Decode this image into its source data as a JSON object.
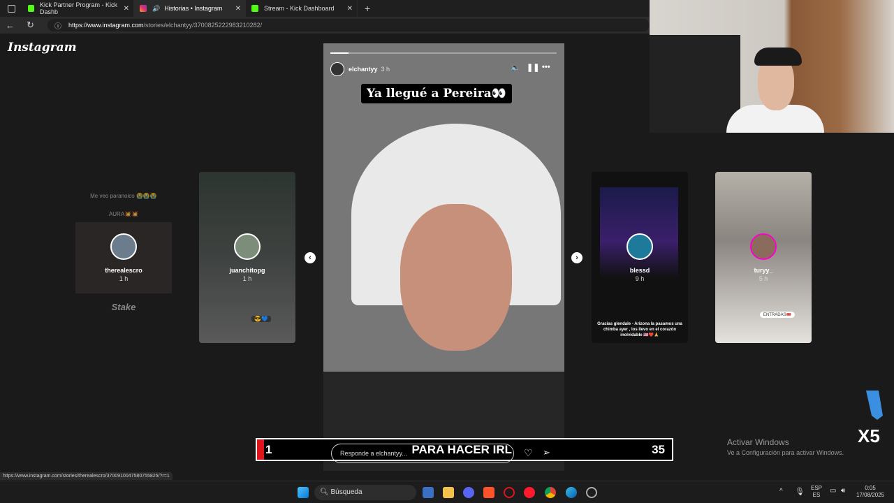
{
  "browser": {
    "tabs": [
      {
        "label": "Kick Partner Program - Kick Dashb"
      },
      {
        "label": "Historias • Instagram"
      },
      {
        "label": "Stream - Kick Dashboard"
      }
    ],
    "new_tab": "+",
    "url_host": "https://www.instagram.com",
    "url_path": "/stories/elchantyy/3700825222983210282/"
  },
  "instagram": {
    "logo": "Instagram",
    "side_stories": [
      {
        "username": "therealescro",
        "time": "1 h",
        "text1": "Me veo paranoico 😭😭😭",
        "text2": "AURA💥💥",
        "text3": "Stake"
      },
      {
        "username": "juanchitopg",
        "time": "1 h",
        "text1": "😎💙"
      },
      {
        "username": "blessd",
        "time": "9 h",
        "text1": "Gracias glendale - Arizona la pasamos una chimba ayer , los llevo en el corazón inolvidable 🇺🇸❤️🙏"
      },
      {
        "username": "turyy_",
        "time": "5 h",
        "text1": "ENTRADAS🎟️"
      }
    ],
    "main_story": {
      "username": "elchantyy",
      "time": "3 h",
      "caption": "Ya llegué a Pereira👀",
      "progress": 0.08,
      "reply_placeholder": "Responde a elchantyy..."
    }
  },
  "stream_overlay": {
    "left_number": "1",
    "text": "PARA HACER IRL",
    "right_number": "35",
    "accent": "#e0141c"
  },
  "multiplier": "X5",
  "windows_watermark": {
    "line1": "Activar Windows",
    "line2": "Ve a Configuración para activar Windows."
  },
  "status_url": "https://www.instagram.com/stories/therealescro/3700910047580755825/?r=1",
  "taskbar": {
    "search": "Búsqueda",
    "lang1": "ESP",
    "lang2": "ES",
    "time": "0:05",
    "date": "17/08/2025"
  }
}
